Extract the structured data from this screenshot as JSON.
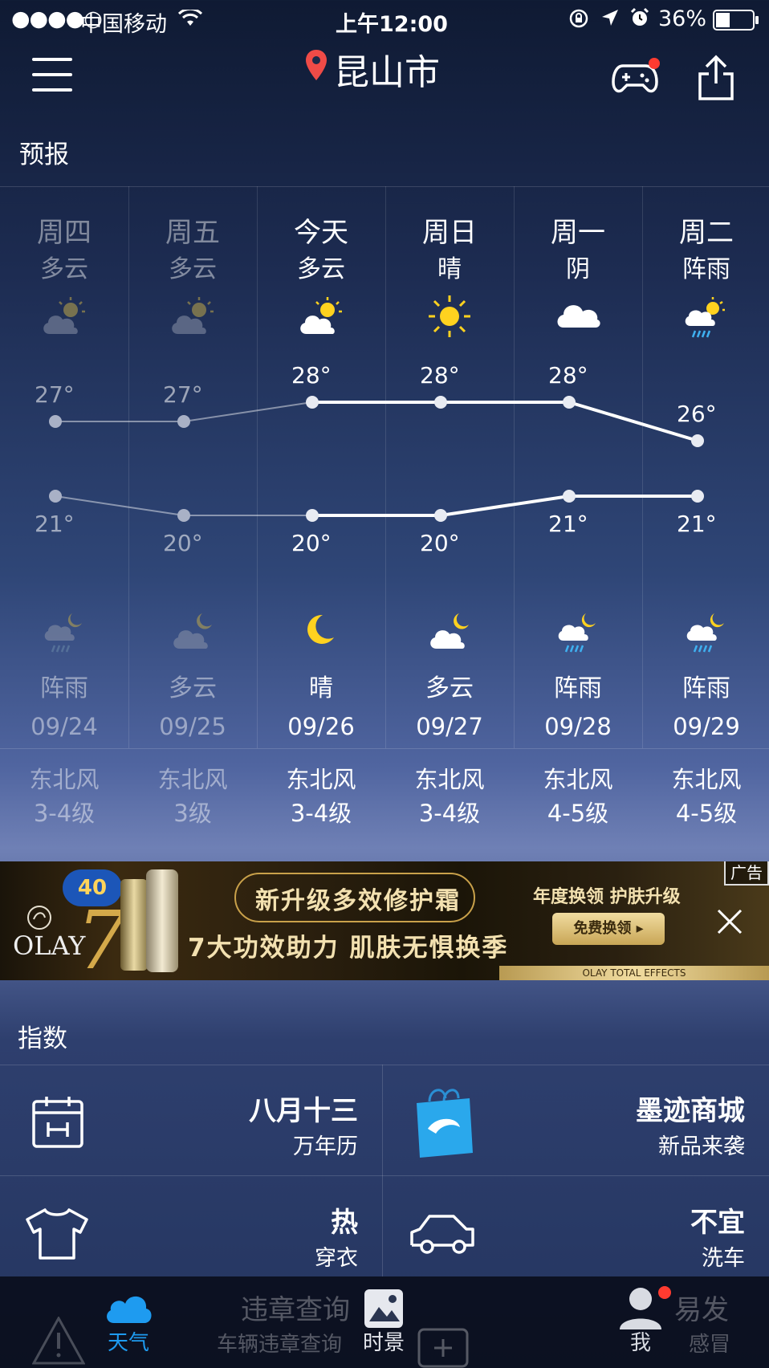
{
  "status_bar": {
    "signal": "●●●●○",
    "carrier": "中国移动",
    "time": "上午12:00",
    "battery": "36%"
  },
  "header": {
    "city": "昆山市"
  },
  "forecast": {
    "title": "预报",
    "days": [
      {
        "day": "周四",
        "day_cond": "多云",
        "day_icon": "partly-cloudy-icon",
        "high": "27°",
        "low": "21°",
        "night_icon": "night-shower-icon",
        "night_cond": "阵雨",
        "date": "09/24",
        "wind_dir": "东北风",
        "wind_level": "3-4级",
        "past": true
      },
      {
        "day": "周五",
        "day_cond": "多云",
        "day_icon": "partly-cloudy-icon",
        "high": "27°",
        "low": "20°",
        "night_icon": "night-cloudy-icon",
        "night_cond": "多云",
        "date": "09/25",
        "wind_dir": "东北风",
        "wind_level": "3级",
        "past": true
      },
      {
        "day": "今天",
        "day_cond": "多云",
        "day_icon": "partly-cloudy-icon",
        "high": "28°",
        "low": "20°",
        "night_icon": "moon-icon",
        "night_cond": "晴",
        "date": "09/26",
        "wind_dir": "东北风",
        "wind_level": "3-4级",
        "past": false
      },
      {
        "day": "周日",
        "day_cond": "晴",
        "day_icon": "sun-icon",
        "high": "28°",
        "low": "20°",
        "night_icon": "night-cloudy-icon",
        "night_cond": "多云",
        "date": "09/27",
        "wind_dir": "东北风",
        "wind_level": "3-4级",
        "past": false
      },
      {
        "day": "周一",
        "day_cond": "阴",
        "day_icon": "cloud-icon",
        "high": "28°",
        "low": "21°",
        "night_icon": "night-shower-icon",
        "night_cond": "阵雨",
        "date": "09/28",
        "wind_dir": "东北风",
        "wind_level": "4-5级",
        "past": false
      },
      {
        "day": "周二",
        "day_cond": "阵雨",
        "day_icon": "shower-icon",
        "high": "26°",
        "low": "21°",
        "night_icon": "night-shower-icon",
        "night_cond": "阵雨",
        "date": "09/29",
        "wind_dir": "东北风",
        "wind_level": "4-5级",
        "past": false
      }
    ]
  },
  "chart_data": {
    "type": "line",
    "categories": [
      "09/24",
      "09/25",
      "09/26",
      "09/27",
      "09/28",
      "09/29"
    ],
    "series": [
      {
        "values": [
          27,
          27,
          28,
          28,
          28,
          26
        ]
      },
      {
        "values": [
          21,
          20,
          20,
          20,
          21,
          21
        ]
      }
    ]
  },
  "ad": {
    "badge": "广告",
    "brand": "OLAY",
    "headline": "新升级多效修护霜",
    "tagline": "7大功效助力 肌肤无惧换季",
    "promo": "年度换领 护肤升级",
    "cta": "免费换领 ▸",
    "footer": "OLAY TOTAL EFFECTS",
    "badge_number": "40",
    "seven": "7"
  },
  "index": {
    "title": "指数",
    "items": [
      {
        "main": "八月十三",
        "sub": "万年历",
        "icon": "calendar-icon"
      },
      {
        "main": "墨迹商城",
        "sub": "新品来袭",
        "icon": "shopping-bag-icon"
      },
      {
        "main": "热",
        "sub": "穿衣",
        "icon": "tshirt-icon"
      },
      {
        "main": "不宜",
        "sub": "洗车",
        "icon": "car-icon"
      }
    ]
  },
  "tabbar": {
    "weather": "天气",
    "violation_title": "违章查询",
    "violation_sub": "车辆违章查询",
    "scenery": "时景",
    "me": "我",
    "flu_title": "易发",
    "flu_sub": "感冒"
  },
  "colors": {
    "accent": "#1e9bf0",
    "pin": "#ef4b47",
    "badge": "#ff3b30",
    "sun": "#ffd21f"
  }
}
